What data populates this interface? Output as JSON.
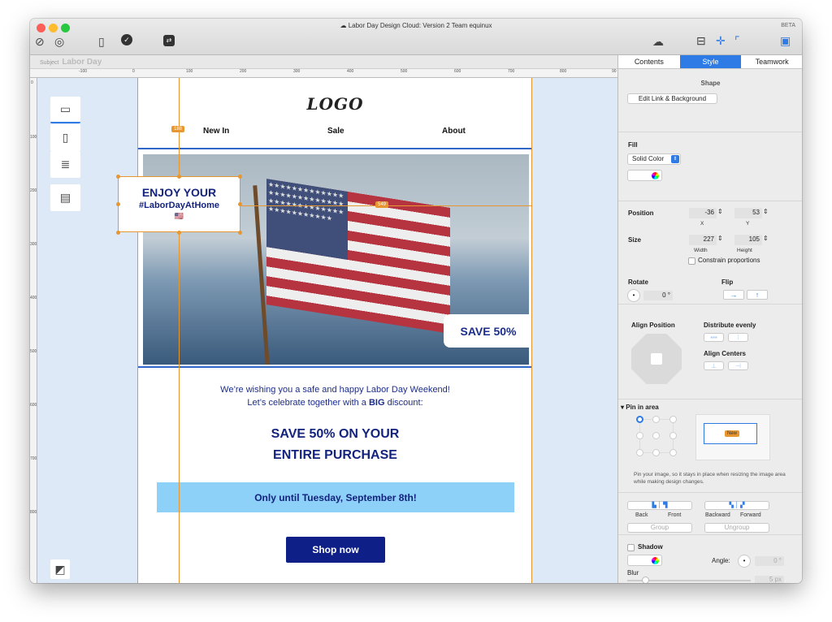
{
  "window": {
    "title": "Labor Day Design Cloud: Version 2 Team equinux",
    "beta_badge": "BETA"
  },
  "subject": {
    "label": "Subject",
    "value": "Labor Day"
  },
  "ruler": {
    "h_ticks": [
      "-100",
      "0",
      "100",
      "200",
      "300",
      "400",
      "500",
      "600",
      "700",
      "800",
      "90"
    ],
    "v_ticks": [
      "0",
      "100",
      "200",
      "300",
      "400",
      "500",
      "600",
      "700",
      "800"
    ]
  },
  "email": {
    "logo": "LOGO",
    "nav": [
      "New In",
      "Sale",
      "About"
    ],
    "hero": {
      "badge": "SAVE 50%",
      "flag_stars": "★★★★★★★★★★★★★★★★★★★★★★★★★★★★★★★★★★★★★★★★★★★★★★★★★★"
    },
    "message_line1": "We’re wishing you a safe and happy Labor Day Weekend!",
    "message_line2_pre": "Let’s celebrate together with a ",
    "message_line2_bold": "BIG",
    "message_line2_post": " discount:",
    "headline_1": "SAVE 50% ON YOUR",
    "headline_2": "ENTIRE PURCHASE",
    "banner": "Only until Tuesday, September 8th!",
    "cta": "Shop now",
    "selected_box": {
      "line1": "ENJOY YOUR",
      "line2": "#LaborDayAtHome",
      "emoji": "🇺🇸"
    }
  },
  "guides": {
    "vertical_badge": "188",
    "horizontal_badge": "549"
  },
  "panel": {
    "tabs": [
      {
        "label": "Contents"
      },
      {
        "label": "Style",
        "active": true
      },
      {
        "label": "Teamwork"
      }
    ],
    "shape": {
      "title": "Shape",
      "edit_button": "Edit Link & Background"
    },
    "fill": {
      "label": "Fill",
      "type": "Solid Color"
    },
    "position": {
      "label": "Position",
      "x": "-36",
      "y": "53",
      "x_label": "X",
      "y_label": "Y"
    },
    "size": {
      "label": "Size",
      "width": "227",
      "height": "105",
      "width_label": "Width",
      "height_label": "Height",
      "constrain": "Constrain proportions"
    },
    "rotate": {
      "label": "Rotate",
      "value": "0 °"
    },
    "flip": {
      "label": "Flip"
    },
    "align": {
      "label": "Align Position",
      "distribute": "Distribute evenly",
      "centers": "Align Centers"
    },
    "pin": {
      "label": "Pin in area",
      "preview_tag": "New",
      "help": "Pin your image, so it stays in place when resizing the image area while making design changes."
    },
    "arrange": {
      "back": "Back",
      "front": "Front",
      "backward": "Backward",
      "forward": "Forward",
      "group": "Group",
      "ungroup": "Ungroup"
    },
    "shadow": {
      "label": "Shadow",
      "angle_label": "Angle:",
      "angle": "0 °",
      "blur_label": "Blur",
      "blur": "5 px"
    }
  },
  "colors": {
    "accent": "#2e7be6",
    "guide": "#e8962f",
    "navy": "#14237e",
    "banner": "#8dd0f8"
  }
}
